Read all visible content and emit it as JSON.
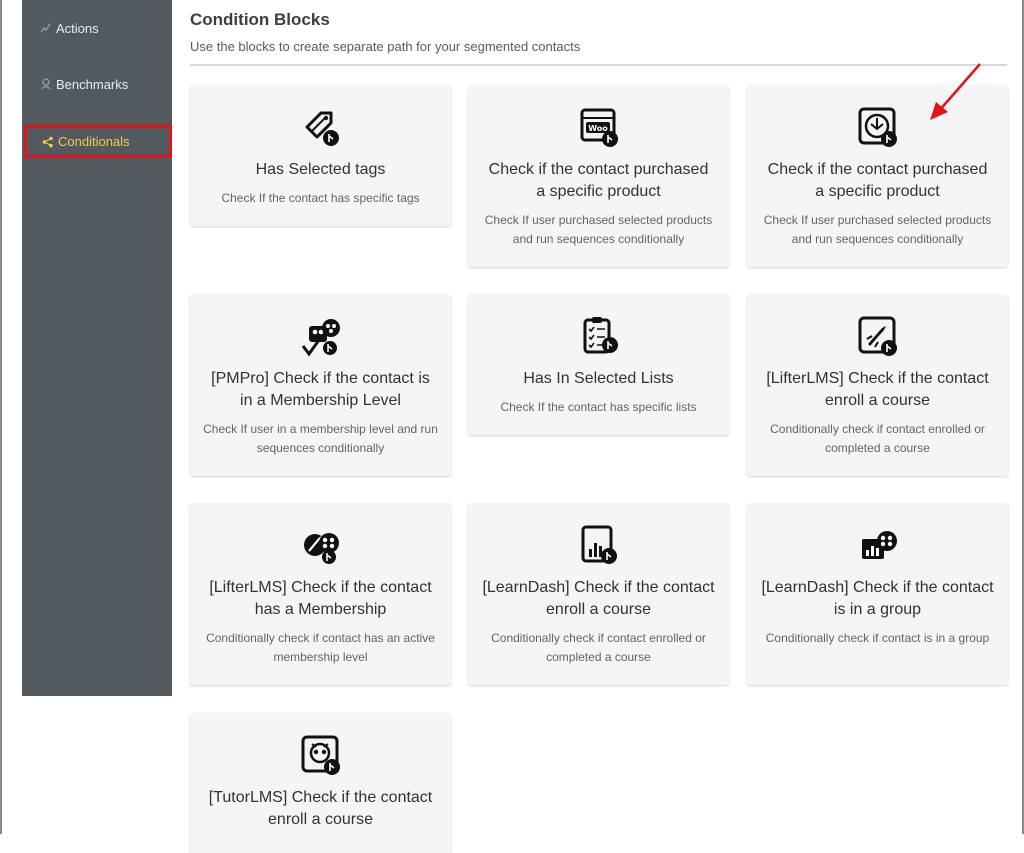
{
  "sidebar": {
    "items": [
      {
        "label": "Actions",
        "icon": "actions-icon"
      },
      {
        "label": "Benchmarks",
        "icon": "benchmark-icon"
      },
      {
        "label": "Conditionals",
        "icon": "share-icon",
        "active": true
      }
    ]
  },
  "main": {
    "title": "Condition Blocks",
    "subtitle": "Use the blocks to create separate path for your segmented contacts"
  },
  "cards": [
    {
      "title": "Has Selected tags",
      "desc": "Check If the contact has specific tags",
      "icon": "tag-icon"
    },
    {
      "title": "Check if the contact purchased a specific product",
      "desc": "Check If user purchased selected products and run sequences conditionally",
      "icon": "woo-icon"
    },
    {
      "title": "Check if the contact purchased a specific product",
      "desc": "Check If user purchased selected products and run sequences conditionally",
      "icon": "edd-icon"
    },
    {
      "title": "[PMPro] Check if the contact is in a Membership Level",
      "desc": "Check If user in a membership level and run sequences conditionally",
      "icon": "membership-check-icon"
    },
    {
      "title": "Has In Selected Lists",
      "desc": "Check If the contact has specific lists",
      "icon": "checklist-icon"
    },
    {
      "title": "[LifterLMS] Check if the contact enroll a course",
      "desc": "Conditionally check if contact enrolled or completed a course",
      "icon": "rocket-icon"
    },
    {
      "title": "[LifterLMS] Check if the contact has a Membership",
      "desc": "Conditionally check if contact has an active membership level",
      "icon": "rocket-group-icon"
    },
    {
      "title": "[LearnDash] Check if the contact enroll a course",
      "desc": "Conditionally check if contact enrolled or completed a course",
      "icon": "bar-chart-icon"
    },
    {
      "title": "[LearnDash] Check if the contact is in a group",
      "desc": "Conditionally check if contact is in a group",
      "icon": "chart-group-icon"
    },
    {
      "title": "[TutorLMS] Check if the contact enroll a course",
      "desc": "",
      "icon": "owl-icon"
    }
  ],
  "colors": {
    "sidebar_bg": "#535a5f",
    "active_text": "#f5c94a",
    "highlight_box": "#e0141a",
    "arrow": "#e0141a",
    "card_bg": "#f5f5f5"
  }
}
